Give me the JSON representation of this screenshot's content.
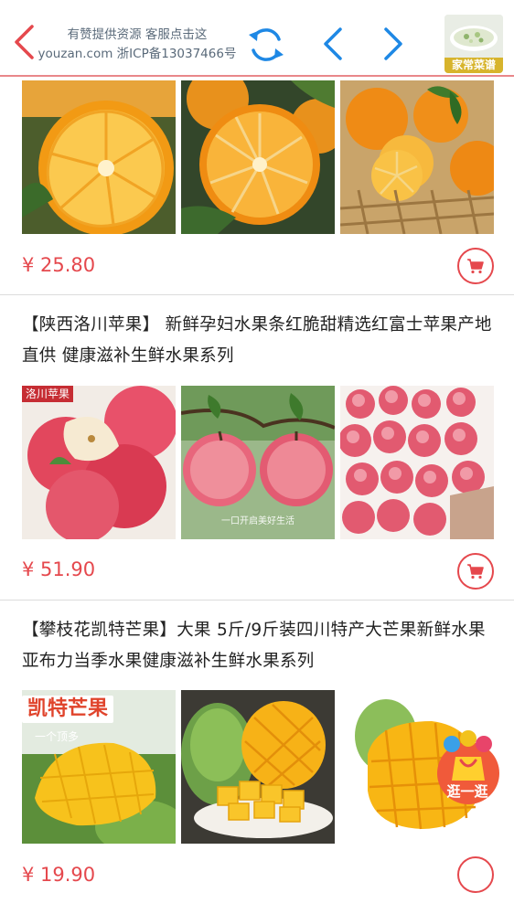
{
  "header": {
    "line1": "有赞提供资源 客服点击这",
    "line2": "youzan.com 浙ICP备13037466号",
    "thumb_label": "家常菜谱"
  },
  "products": [
    {
      "price": "¥ 25.80"
    },
    {
      "title": "【陕西洛川苹果】 新鲜孕妇水果条红脆甜精选红富士苹果产地直供 健康滋补生鲜水果系列",
      "price": "¥ 51.90",
      "image_tag": "洛川苹果",
      "image_caption": "一口开启美好生活"
    },
    {
      "title": "【攀枝花凯特芒果】大果 5斤/9斤装四川特产大芒果新鲜水果 亚布力当季水果健康滋补生鲜水果系列",
      "price": "¥ 19.90",
      "image_badge": "凯特芒果",
      "image_sub": "一个顶多"
    }
  ],
  "float_button": {
    "label": "逛一逛"
  },
  "colors": {
    "accent": "#e5484d",
    "nav_blue": "#1e88e5",
    "header_line": "#e9878a"
  }
}
